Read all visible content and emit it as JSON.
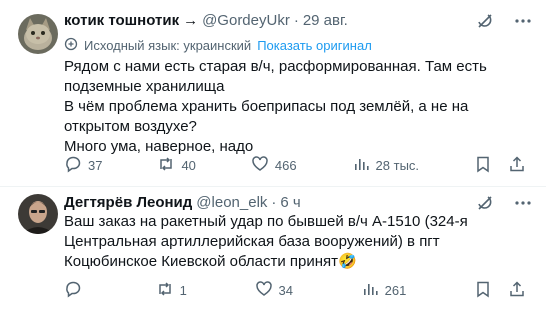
{
  "tweets": [
    {
      "name": "котик тошнотик",
      "arrow": "→",
      "handle": "@GordeyUkr",
      "dot": "·",
      "time": "29 авг.",
      "translate_note": "Исходный язык: украинский",
      "translate_link": "Показать оригинал",
      "lines": [
        "Рядом с нами есть старая в/ч, расформированная. Там есть подземные хранилища",
        "В чём проблема хранить боеприпасы под землёй, а не на открытом воздухе?",
        "Много ума, наверное, надо"
      ],
      "stats": {
        "replies": "37",
        "retweets": "40",
        "likes": "466",
        "views": "28 тыс."
      }
    },
    {
      "name": "Дегтярёв Леонид",
      "handle": "@leon_elk",
      "dot": "·",
      "time": "6 ч",
      "text": "Ваш заказ на ракетный удар по бывшей в/ч А-1510 (324-я Центральная артиллерийская база вооружений) в пгт Коцюбинское Киевской области принят🤣",
      "stats": {
        "replies": "",
        "retweets": "1",
        "likes": "34",
        "views": "261"
      }
    }
  ],
  "icons": {
    "reply": "reply-icon",
    "retweet": "retweet-icon",
    "like": "heart-icon",
    "views": "views-icon",
    "bookmark": "bookmark-icon",
    "share": "share-icon",
    "grok": "grok-icon",
    "more": "more-icon",
    "translate": "translate-icon"
  },
  "colors": {
    "link": "#1d9bf0",
    "muted": "#536471",
    "text": "#0f1419"
  }
}
